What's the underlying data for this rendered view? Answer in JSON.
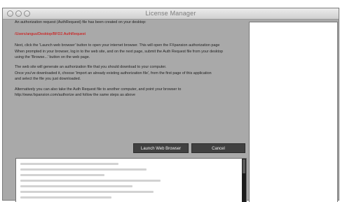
{
  "window": {
    "title": "License Manager"
  },
  "message": {
    "line1": "An authorization request (AuthRequest) file has been created on your desktop:",
    "path": "/Users/angus/Desktop/BFD2.AuthRequest",
    "line2": "Next, click the 'Launch web browser' button to open your internet browser. This will open the FXpansion authorization page",
    "line3": "When prompted in your browser, log in to the web site, and on the next page, submit the Auth Request file from your desktop",
    "line4": "using the 'Browse...' button on the web page.",
    "line5": "The web site will generate an authorization file that you should download to your computer.",
    "line6": "Once you've downloaded it, choose 'Import an already existing authorization file', from the first page of this application",
    "line7": "and select the file you just downloaded.",
    "line8": "Alternatively you can also take the Auth Request file to another computer, and point your browser to",
    "line9": "http://www.fxpansion.com/authorize and follow the same steps as above"
  },
  "buttons": {
    "launch": "Launch Web Browser",
    "cancel": "Cancel"
  }
}
